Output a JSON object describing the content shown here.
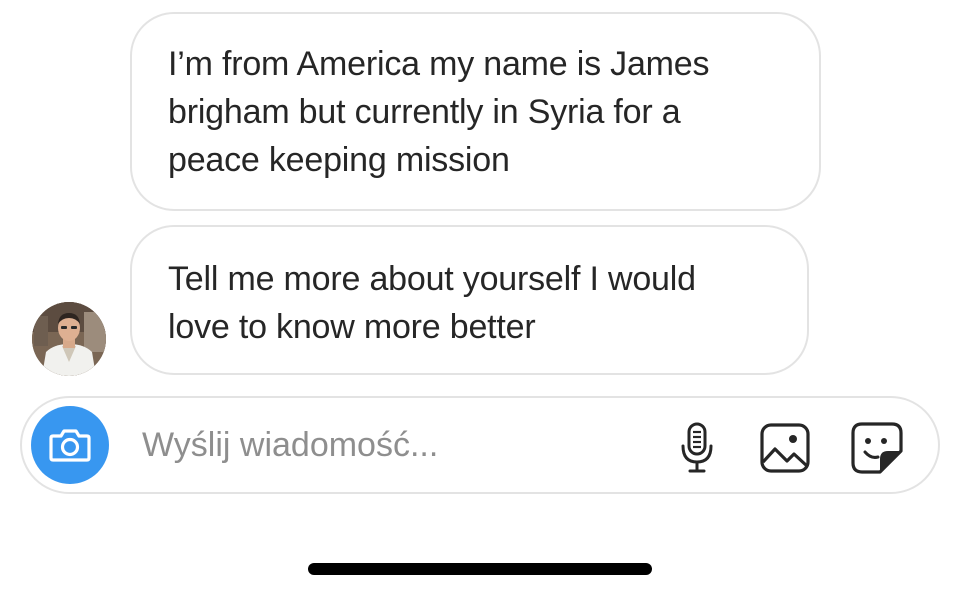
{
  "messages": [
    {
      "sender": "other",
      "lines": [
        "I’m from America my name is James",
        "brigham but currently in Syria for a",
        "peace keeping mission"
      ]
    },
    {
      "sender": "other",
      "lines": [
        "Tell me more about yourself I would",
        "love to know more better"
      ]
    }
  ],
  "composer": {
    "placeholder": "Wyślij wiadomość...",
    "value": "",
    "camera_icon": "camera-icon",
    "mic_icon": "microphone-icon",
    "gallery_icon": "image-gallery-icon",
    "sticker_icon": "sticker-icon",
    "accent_color": "#3897f0"
  },
  "avatar_icon": "avatar"
}
